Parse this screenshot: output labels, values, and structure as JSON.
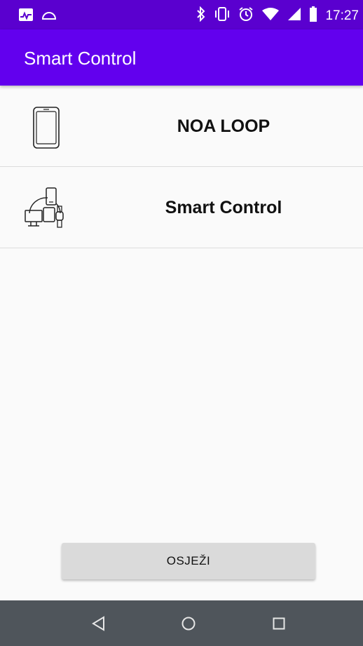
{
  "status_bar": {
    "time": "17:27",
    "icons": [
      "activity-icon",
      "cloud-icon",
      "bluetooth-icon",
      "vibrate-icon",
      "alarm-icon",
      "wifi-icon",
      "signal-icon",
      "battery-icon"
    ]
  },
  "app_bar": {
    "title": "Smart Control",
    "color": "#6200ee"
  },
  "list": {
    "items": [
      {
        "label": "NOA LOOP",
        "icon": "smartphone-icon"
      },
      {
        "label": "Smart Control",
        "icon": "connected-devices-icon"
      }
    ]
  },
  "refresh_button": {
    "label": "OSJEŽI"
  },
  "nav_bar": {
    "buttons": [
      "back-icon",
      "home-icon",
      "recents-icon"
    ]
  }
}
